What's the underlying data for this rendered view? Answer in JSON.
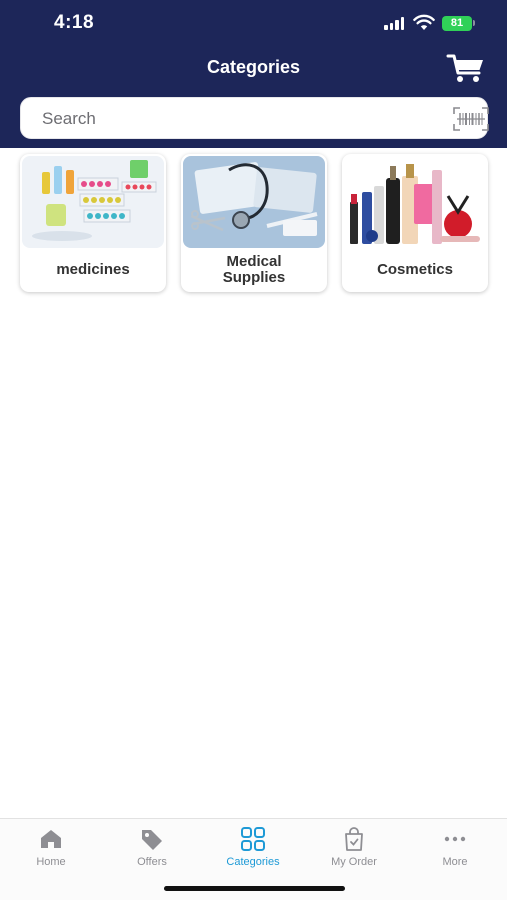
{
  "status_bar": {
    "time": "4:18",
    "battery": "81"
  },
  "header": {
    "title": "Categories",
    "cart_icon": "cart-icon"
  },
  "search": {
    "placeholder": "Search",
    "scan_icon": "barcode-scan-icon"
  },
  "categories": [
    {
      "label": "medicines"
    },
    {
      "label": "Medical\nSupplies"
    },
    {
      "label": "Cosmetics"
    }
  ],
  "tabs": [
    {
      "label": "Home",
      "icon": "home-icon",
      "active": false
    },
    {
      "label": "Offers",
      "icon": "tag-icon",
      "active": false
    },
    {
      "label": "Categories",
      "icon": "grid-icon",
      "active": true
    },
    {
      "label": "My Order",
      "icon": "shopping-bag-icon",
      "active": false
    },
    {
      "label": "More",
      "icon": "more-dots-icon",
      "active": false
    }
  ],
  "colors": {
    "header_bg": "#1d2659",
    "accent": "#1e9ad6",
    "tab_inactive": "#8e8e93",
    "battery": "#30d158"
  }
}
